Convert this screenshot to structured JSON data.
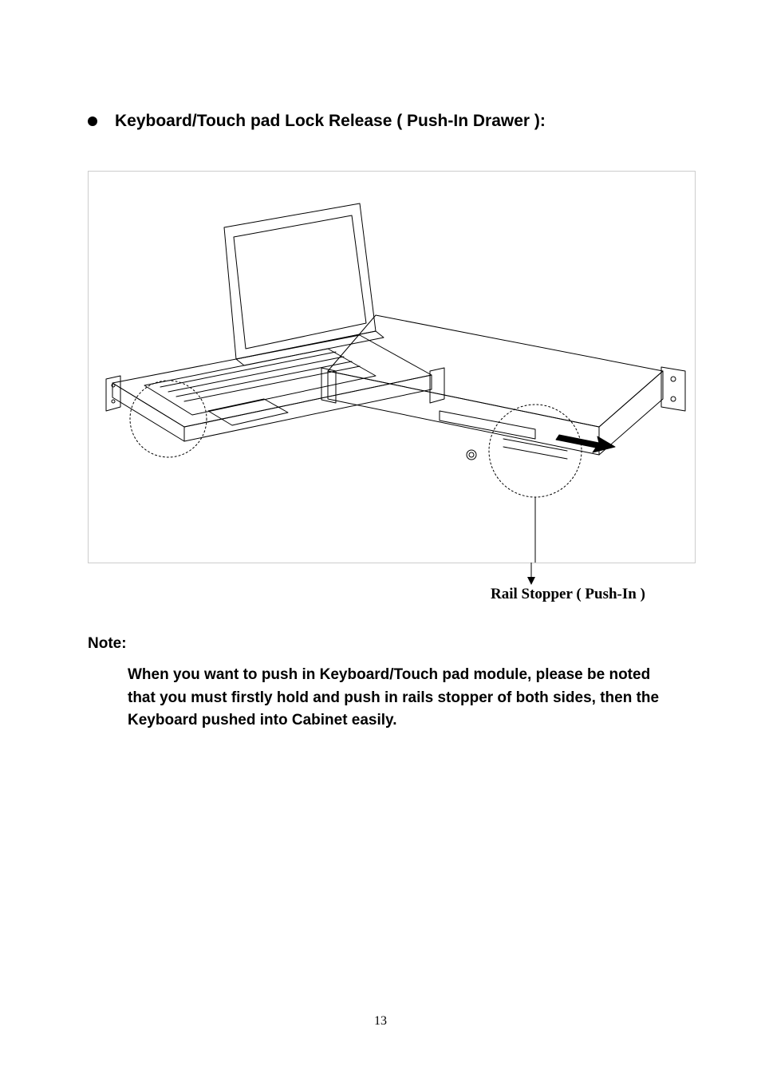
{
  "heading": "Keyboard/Touch pad Lock Release ( Push-In Drawer ):",
  "figure": {
    "caption": "Rail Stopper ( Push-In )"
  },
  "note": {
    "label": "Note:",
    "body": "When you want to push in Keyboard/Touch pad module, please be noted that you must firstly hold and push in rails stopper of both sides, then the Keyboard pushed into Cabinet easily."
  },
  "page_number": "13"
}
